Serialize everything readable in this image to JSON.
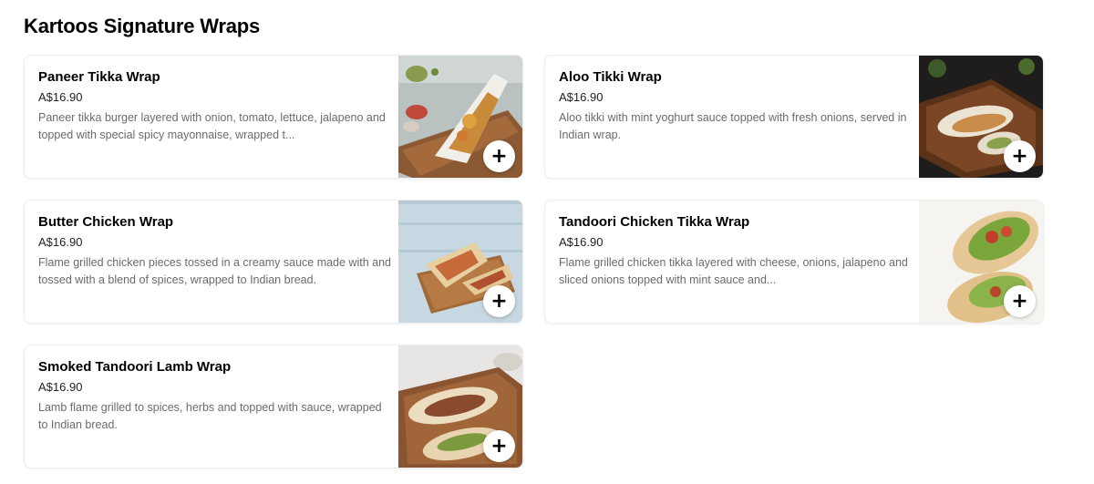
{
  "section": {
    "title": "Kartoos Signature Wraps"
  },
  "items": [
    {
      "name": "Paneer Tikka Wrap",
      "price": "A$16.90",
      "description": "Paneer tikka burger layered with onion, tomato, lettuce, jalapeno and topped with special spicy mayonnaise, wrapped t...",
      "add_label": "+"
    },
    {
      "name": "Aloo Tikki Wrap",
      "price": "A$16.90",
      "description": "Aloo tikki with mint yoghurt sauce topped with fresh onions, served in Indian wrap.",
      "add_label": "+"
    },
    {
      "name": "Butter Chicken Wrap",
      "price": "A$16.90",
      "description": "Flame grilled chicken pieces tossed in a creamy sauce made with and tossed with a blend of spices, wrapped to Indian bread.",
      "add_label": "+"
    },
    {
      "name": "Tandoori Chicken Tikka Wrap",
      "price": "A$16.90",
      "description": "Flame grilled chicken tikka layered with cheese, onions, jalapeno and sliced onions topped with mint sauce and...",
      "add_label": "+"
    },
    {
      "name": "Smoked Tandoori Lamb Wrap",
      "price": "A$16.90",
      "description": "Lamb flame grilled to spices, herbs and topped with sauce, wrapped to Indian bread.",
      "add_label": "+"
    }
  ]
}
